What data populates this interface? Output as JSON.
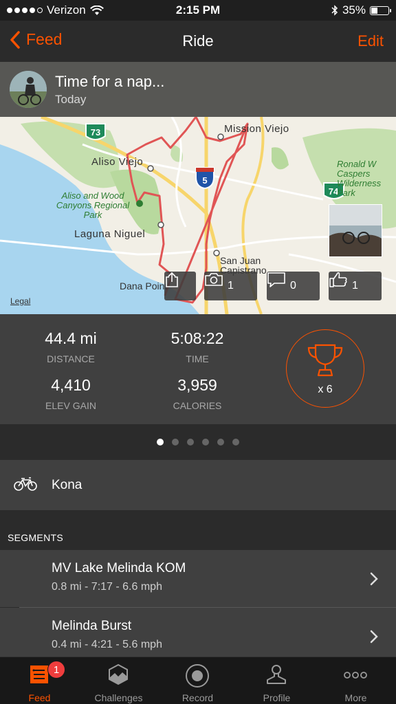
{
  "status_bar": {
    "carrier": "Verizon",
    "time": "2:15 PM",
    "battery": "35%",
    "signal_dots_filled": 4,
    "signal_dots_total": 5
  },
  "nav": {
    "back_label": "Feed",
    "title": "Ride",
    "edit_label": "Edit"
  },
  "activity": {
    "name": "Time for a nap...",
    "date": "Today"
  },
  "map": {
    "places": [
      "Mission Viejo",
      "Aliso Viejo",
      "Laguna Niguel",
      "San Juan Capistrano",
      "Dana Point"
    ],
    "parks": [
      "Aliso and Wood Canyons Regional Park",
      "Ronald W Caspers Wilderness Park"
    ],
    "highway_shields": [
      "73",
      "5",
      "74"
    ],
    "legal": "Legal",
    "buttons": {
      "share_icon": "share-icon",
      "photo_count": "1",
      "comment_count": "0",
      "kudos_count": "1"
    }
  },
  "stats": {
    "distance": {
      "value": "44.4 mi",
      "label": "DISTANCE"
    },
    "time": {
      "value": "5:08:22",
      "label": "TIME"
    },
    "elev_gain": {
      "value": "4,410",
      "label": "ELEV GAIN"
    },
    "calories": {
      "value": "3,959",
      "label": "CALORIES"
    },
    "achievements": "x 6"
  },
  "pager": {
    "pages": 6,
    "active_index": 0
  },
  "gear": {
    "name": "Kona"
  },
  "segments": {
    "heading": "SEGMENTS",
    "items": [
      {
        "name": "MV Lake Melinda KOM",
        "details": "0.8 mi - 7:17 - 6.6 mph"
      },
      {
        "name": "Melinda Burst",
        "details": "0.4 mi - 4:21 - 5.6 mph"
      }
    ]
  },
  "tabbar": {
    "tabs": [
      {
        "label": "Feed",
        "icon": "feed-icon",
        "active": true,
        "badge": "1"
      },
      {
        "label": "Challenges",
        "icon": "challenges-icon",
        "active": false
      },
      {
        "label": "Record",
        "icon": "record-icon",
        "active": false
      },
      {
        "label": "Profile",
        "icon": "profile-icon",
        "active": false
      },
      {
        "label": "More",
        "icon": "more-icon",
        "active": false
      }
    ]
  },
  "colors": {
    "accent": "#fc5200",
    "background": "#2b2b2b",
    "panel": "#404040",
    "route": "#e05555",
    "badge": "#ef3d3d"
  }
}
